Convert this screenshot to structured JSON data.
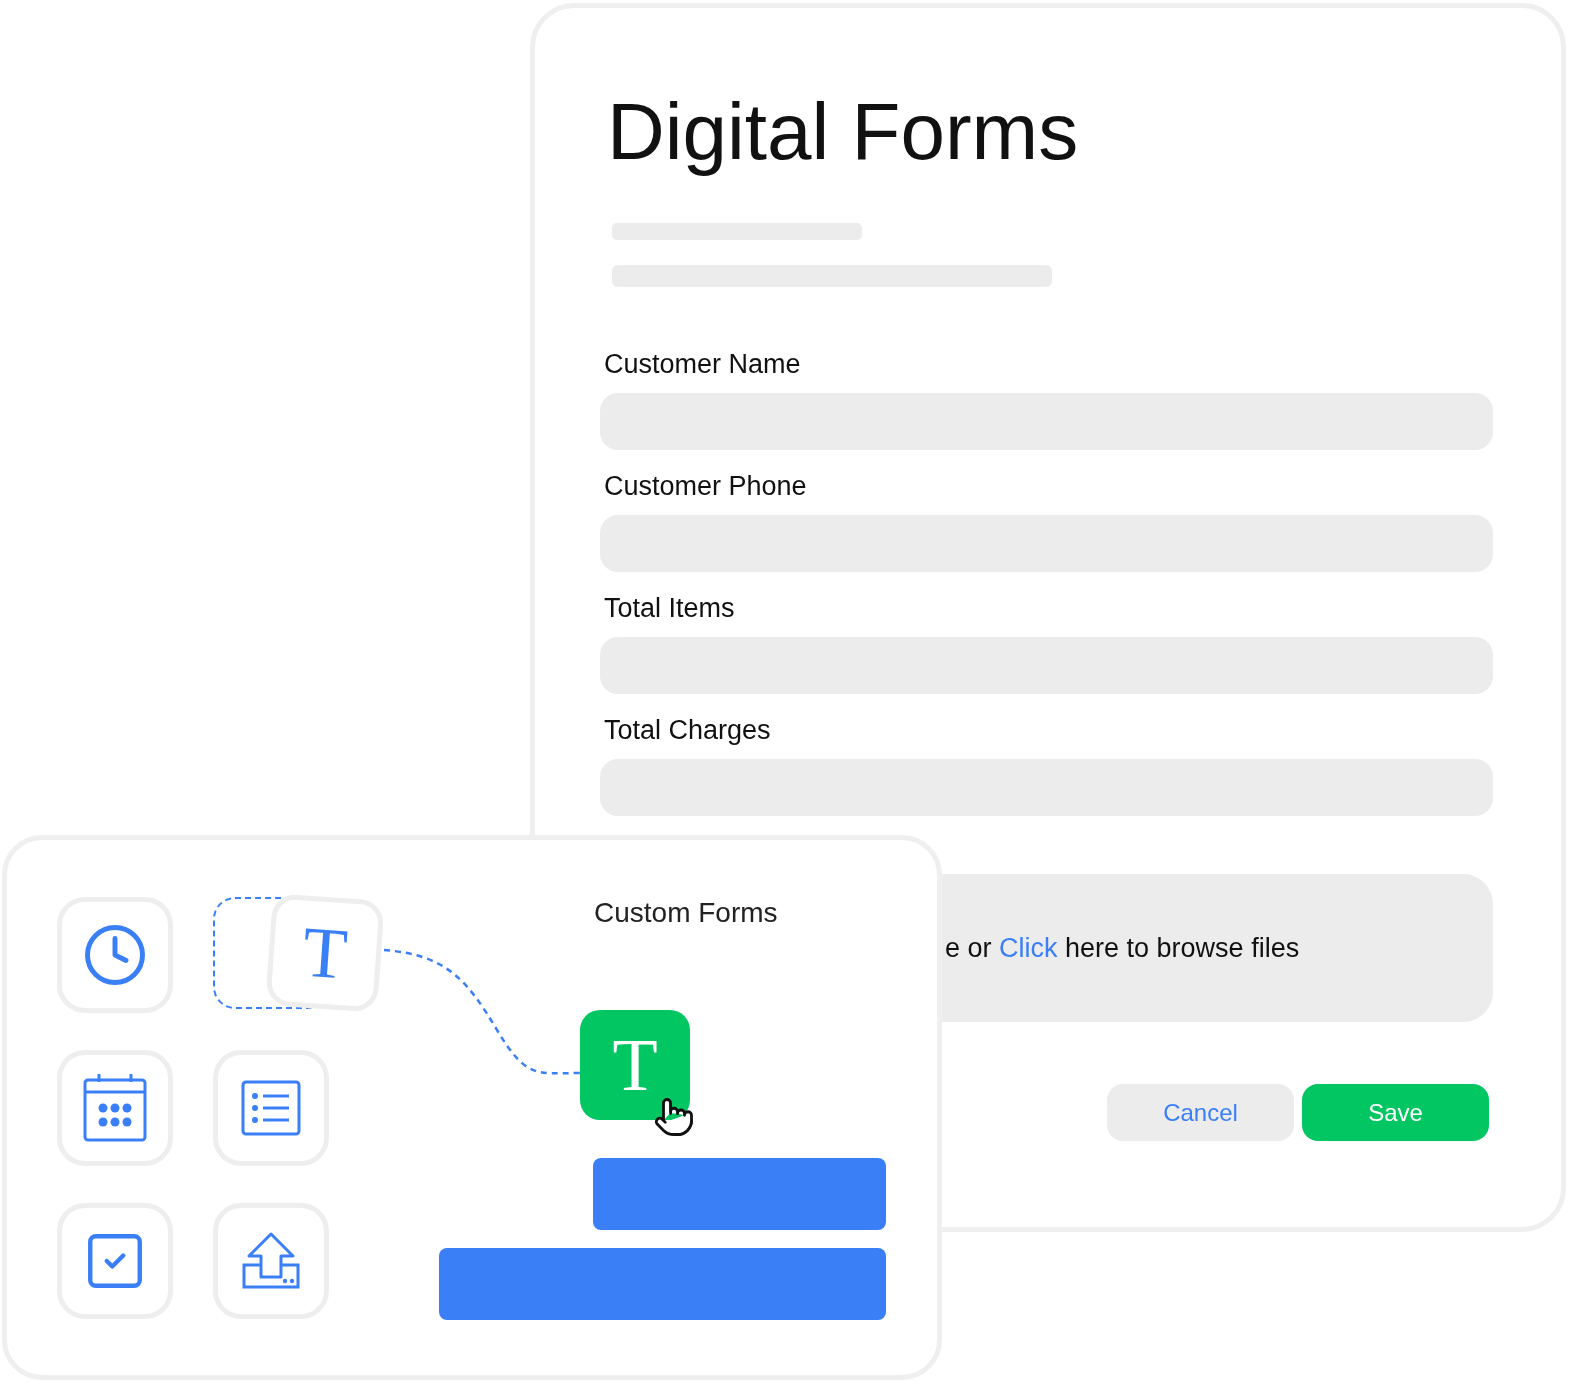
{
  "form": {
    "title": "Digital Forms",
    "fields": [
      {
        "label": "Customer Name"
      },
      {
        "label": "Customer Phone"
      },
      {
        "label": "Total Items"
      },
      {
        "label": "Total Charges"
      }
    ],
    "upload": {
      "before": "e or ",
      "link": "Click",
      "after": " here to browse files"
    },
    "buttons": [
      {
        "label": "Cancel",
        "kind": "secondary"
      },
      {
        "label": "Save",
        "kind": "primary"
      }
    ]
  },
  "builder": {
    "title": "Custom Forms",
    "tools": [
      {
        "kind": "clock"
      },
      {
        "kind": "slot"
      },
      {
        "kind": "calendar"
      },
      {
        "kind": "list"
      },
      {
        "kind": "checkbox"
      },
      {
        "kind": "upload"
      }
    ],
    "dragged": {
      "glyph": "T"
    },
    "dropped": {
      "glyph": "T"
    }
  }
}
